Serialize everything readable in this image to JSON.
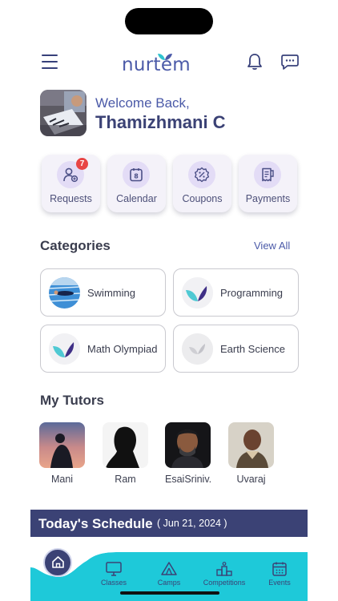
{
  "app": {
    "logo_text": "nurtem"
  },
  "header": {
    "menu_icon": "hamburger-menu-icon",
    "bell_icon": "bell-icon",
    "chat_icon": "chat-icon"
  },
  "welcome": {
    "greeting": "Welcome Back,",
    "name": "Thamizhmani C"
  },
  "quick_actions": [
    {
      "label": "Requests",
      "icon": "user-request-icon",
      "badge": "7"
    },
    {
      "label": "Calendar",
      "icon": "calendar-icon"
    },
    {
      "label": "Coupons",
      "icon": "coupon-icon"
    },
    {
      "label": "Payments",
      "icon": "payments-icon"
    }
  ],
  "categories": {
    "title": "Categories",
    "view_all": "View All",
    "items": [
      {
        "label": "Swimming"
      },
      {
        "label": "Programming"
      },
      {
        "label": "Math Olympiad"
      },
      {
        "label": "Earth Science"
      }
    ]
  },
  "tutors": {
    "title": "My Tutors",
    "items": [
      {
        "name": "Mani"
      },
      {
        "name": "Ram"
      },
      {
        "name": "EsaiSriniv..."
      },
      {
        "name": "Uvaraj"
      }
    ]
  },
  "schedule": {
    "title": "Today's Schedule",
    "date": "( Jun 21, 2024 )"
  },
  "bottom_nav": [
    {
      "label": "Classes",
      "icon": "monitor-icon"
    },
    {
      "label": "Camps",
      "icon": "tent-icon"
    },
    {
      "label": "Competitions",
      "icon": "podium-icon"
    },
    {
      "label": "Events",
      "icon": "calendar-grid-icon"
    }
  ],
  "colors": {
    "primary": "#3b4275",
    "accent": "#1ec9d9",
    "badge": "#e84545",
    "icon_bg": "#e3dcf6"
  }
}
